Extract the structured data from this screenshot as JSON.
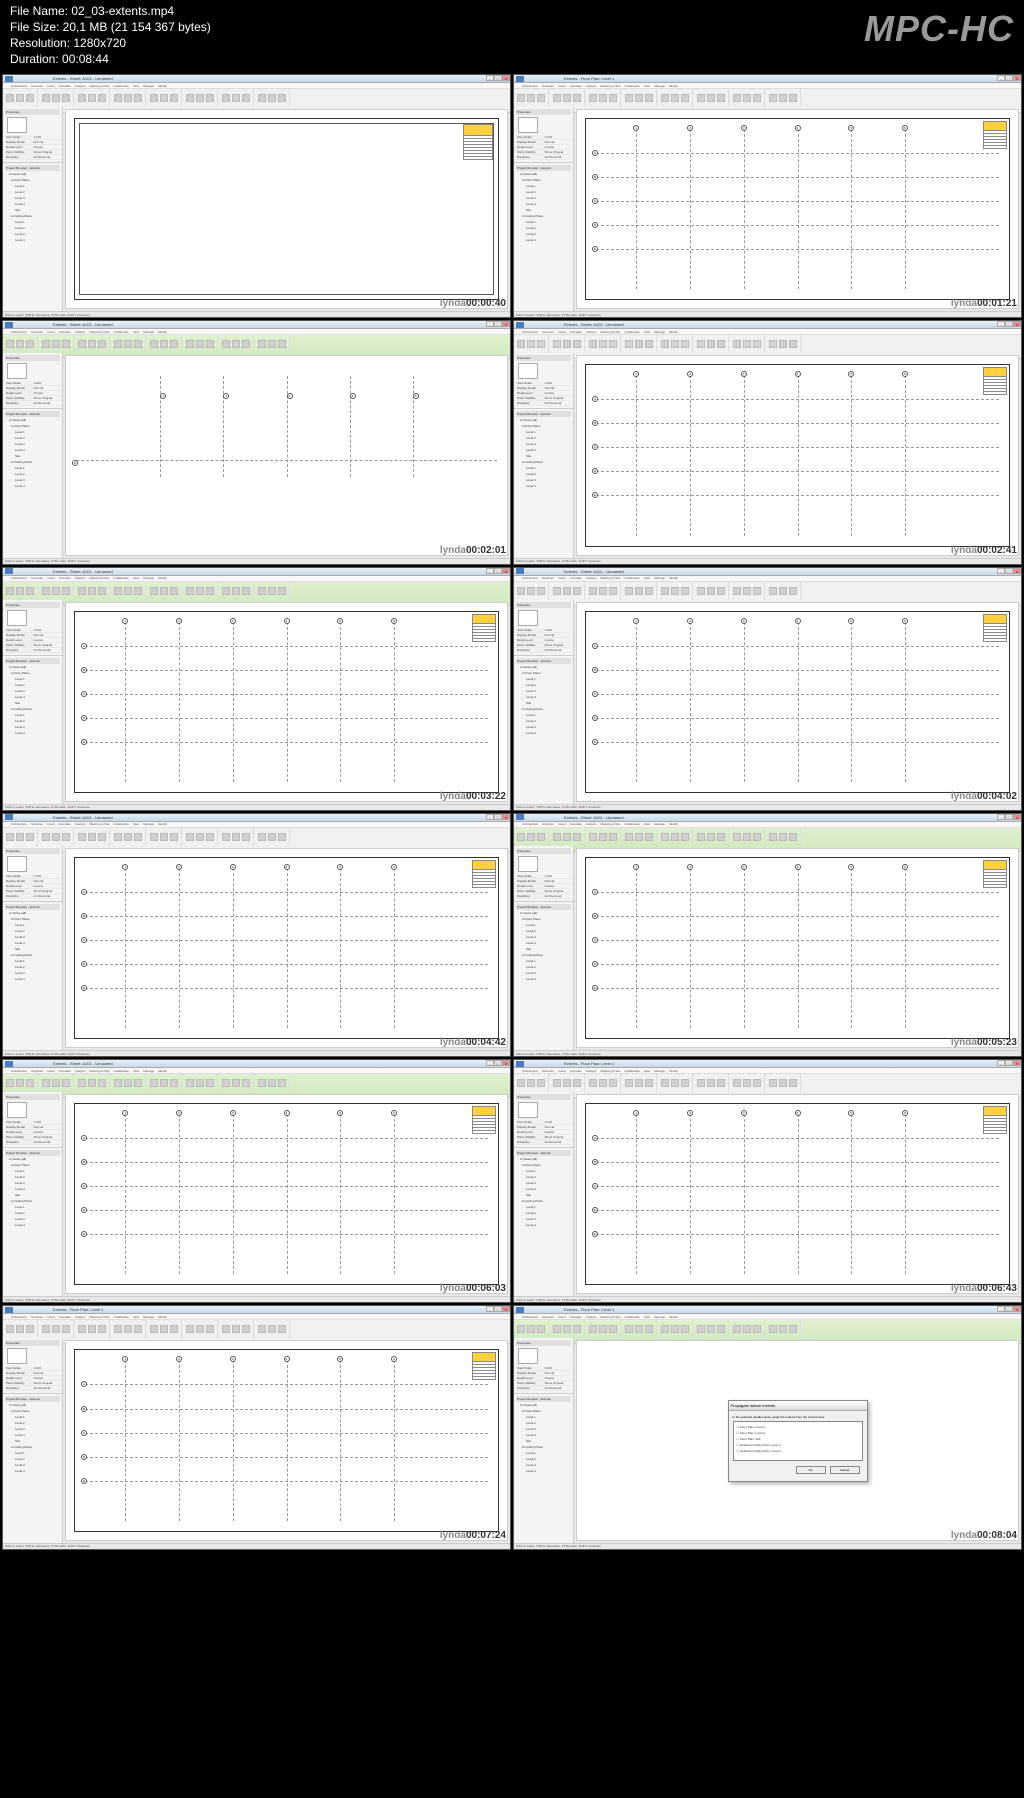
{
  "header": {
    "filename": "File Name: 02_03-extents.mp4",
    "filesize": "File Size: 20,1 MB (21 154 367 bytes)",
    "resolution": "Resolution: 1280x720",
    "duration": "Duration: 00:08:44"
  },
  "logo": "MPC-HC",
  "brand": "lynda",
  "app_title": "Extents - Sheet: A101 - Unnamed",
  "app_title_floor": "Extents - Floor Plan: Level 1",
  "ribbon_tabs": [
    "Architecture",
    "Structure",
    "Insert",
    "Annotate",
    "Analyze",
    "Massing & Site",
    "Collaborate",
    "View",
    "Manage",
    "Modify"
  ],
  "properties_title": "Properties",
  "browser_title": "Project Browser - Extents",
  "tree": {
    "views": "Views (all)",
    "floorplans": "Floor Plans",
    "levels": [
      "Level 1",
      "Level 2",
      "Level 3",
      "Level 4",
      "Site"
    ],
    "ceilingplans": "Ceiling Plans"
  },
  "props": {
    "view_name": "Floor Plan",
    "scale": "1:100",
    "display_model": "Normal",
    "detail_level": "Coarse",
    "parts_visibility": "Show Original",
    "discipline": "Architectural"
  },
  "thumbnails": [
    {
      "ts": "00:00:40",
      "type": "sheet",
      "title": "Extents - Sheet: A101 - Unnamed",
      "ribbon": "normal"
    },
    {
      "ts": "00:01:21",
      "type": "grid",
      "title": "Extents - Floor Plan: Level 1",
      "ribbon": "normal"
    },
    {
      "ts": "00:02:01",
      "type": "grid-partial",
      "title": "Extents - Sheet: A101 - Unnamed",
      "ribbon": "green"
    },
    {
      "ts": "00:02:41",
      "type": "grid",
      "title": "Extents - Sheet: A101 - Unnamed",
      "ribbon": "normal"
    },
    {
      "ts": "00:03:22",
      "type": "grid-select",
      "title": "Extents - Sheet: A101 - Unnamed",
      "ribbon": "green"
    },
    {
      "ts": "00:04:02",
      "type": "grid",
      "title": "Extents - Sheet: A101 - Unnamed",
      "ribbon": "normal"
    },
    {
      "ts": "00:04:42",
      "type": "grid",
      "title": "Extents - Sheet: A101 - Unnamed",
      "ribbon": "normal"
    },
    {
      "ts": "00:05:23",
      "type": "grid",
      "title": "Extents - Sheet: A101 - Unnamed",
      "ribbon": "green"
    },
    {
      "ts": "00:06:03",
      "type": "grid",
      "title": "Extents - Sheet: A101 - Unnamed",
      "ribbon": "green"
    },
    {
      "ts": "00:06:43",
      "type": "grid",
      "title": "Extents - Floor Plan: Level 1",
      "ribbon": "normal"
    },
    {
      "ts": "00:07:24",
      "type": "grid",
      "title": "Extents - Floor Plan: Level 1",
      "ribbon": "normal"
    },
    {
      "ts": "00:08:04",
      "type": "dialog",
      "title": "Extents - Floor Plan: Level 1",
      "ribbon": "green"
    }
  ],
  "dialog": {
    "title": "Propagate datum extents",
    "text": "In the selected parallel views, apply the extents from the current view:",
    "items": [
      "Floor Plan: Level 1",
      "Floor Plan: Level 2",
      "Floor Plan: Site",
      "Reflected Ceiling Plan: Level 1",
      "Reflected Ceiling Plan: Level 2"
    ],
    "ok": "OK",
    "cancel": "Cancel"
  },
  "status_text": "Click to select, TAB for alternates, CTRL adds, SHIFT unselects.",
  "tooltip": "Floor Plan: Level 1"
}
